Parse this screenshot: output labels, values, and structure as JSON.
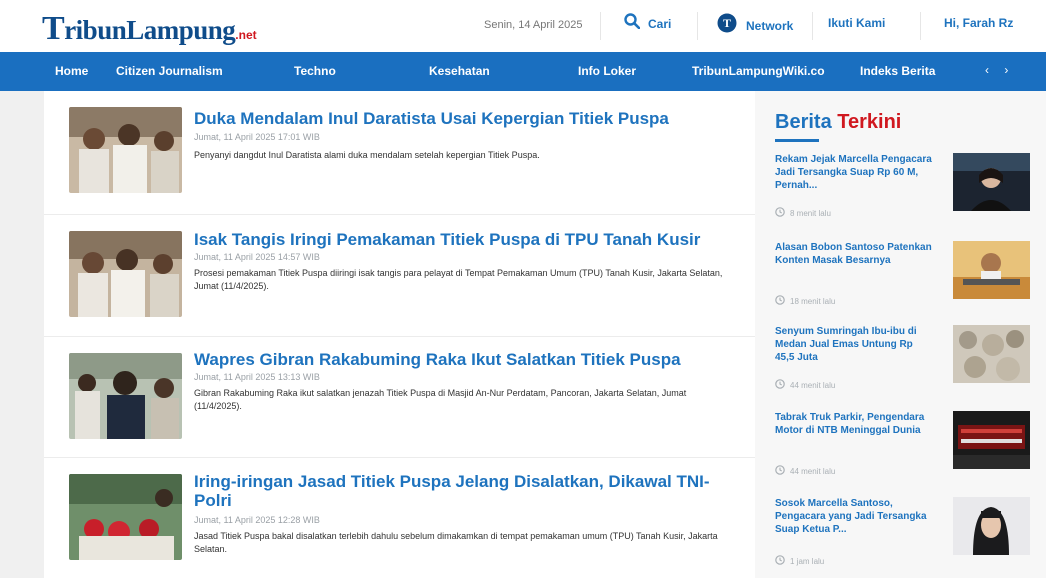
{
  "header": {
    "logo": {
      "initial": "T",
      "rest": "ribunLampung",
      "suffix": ".net"
    },
    "date": "Senin, 14 April 2025",
    "search_label": "Cari",
    "network_label": "Network",
    "follow_label": "Ikuti Kami",
    "user_label": "Hi, Farah Rz"
  },
  "nav": {
    "items": [
      "Home",
      "Citizen Journalism",
      "Techno",
      "Kesehatan",
      "Info Loker",
      "TribunLampungWiki.co",
      "Indeks Berita"
    ],
    "arrows": "‹ ›"
  },
  "articles": [
    {
      "title": "Duka Mendalam Inul Daratista Usai Kepergian Titiek Puspa",
      "date": "Jumat, 11 April 2025 17:01 WIB",
      "excerpt": "Penyanyi dangdut Inul Daratista alami duka mendalam setelah kepergian Titiek Puspa."
    },
    {
      "title": "Isak Tangis Iringi Pemakaman Titiek Puspa di TPU Tanah Kusir",
      "date": "Jumat, 11 April 2025 14:57 WIB",
      "excerpt": "Prosesi pemakaman Titiek Puspa diiringi isak tangis para pelayat di Tempat Pemakaman Umum (TPU) Tanah Kusir, Jakarta Selatan, Jumat (11/4/2025)."
    },
    {
      "title": "Wapres Gibran Rakabuming Raka Ikut Salatkan Titiek Puspa",
      "date": "Jumat, 11 April 2025 13:13 WIB",
      "excerpt": "Gibran Rakabuming Raka ikut salatkan jenazah Titiek Puspa di Masjid An-Nur Perdatam, Pancoran, Jakarta Selatan, Jumat (11/4/2025)."
    },
    {
      "title": "Iring-iringan Jasad Titiek Puspa Jelang Disalatkan, Dikawal TNI-Polri",
      "date": "Jumat, 11 April 2025 12:28 WIB",
      "excerpt": "Jasad Titiek Puspa bakal disalatkan terlebih dahulu sebelum dimakamkan di tempat pemakaman umum (TPU) Tanah Kusir, Jakarta Selatan."
    }
  ],
  "sidebar": {
    "title_blue": "Berita",
    "title_red": "Terkini",
    "items": [
      {
        "title": "Rekam Jejak Marcella Pengacara Jadi Tersangka Suap Rp 60 M, Pernah...",
        "time": "8 menit lalu"
      },
      {
        "title": "Alasan Bobon Santoso Patenkan Konten Masak Besarnya",
        "time": "18 menit lalu"
      },
      {
        "title": "Senyum Sumringah Ibu-ibu di Medan Jual Emas Untung Rp 45,5 Juta",
        "time": "44 menit lalu"
      },
      {
        "title": "Tabrak Truk Parkir, Pengendara Motor di NTB Meninggal Dunia",
        "time": "44 menit lalu"
      },
      {
        "title": "Sosok Marcella Santoso, Pengacara yang Jadi Tersangka Suap Ketua P...",
        "time": "1 jam lalu"
      }
    ]
  },
  "colors": {
    "brand_blue": "#1a6fc0",
    "link_blue": "#1e73be",
    "accent_red": "#d0181f"
  }
}
